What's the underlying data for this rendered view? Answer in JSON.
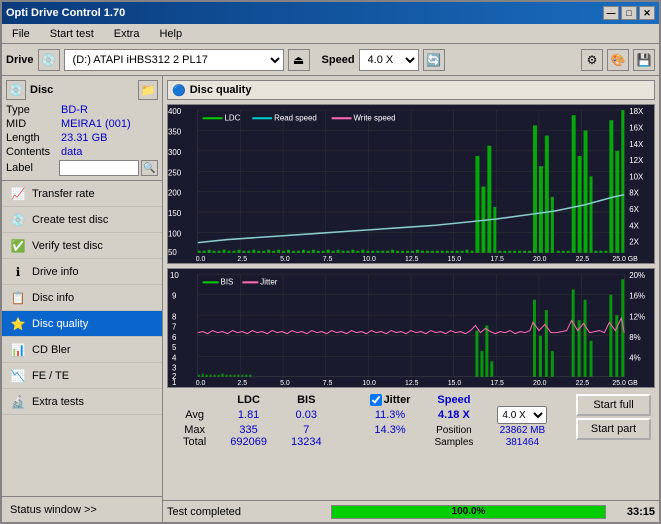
{
  "window": {
    "title": "Opti Drive Control 1.70",
    "controls": [
      "—",
      "□",
      "✕"
    ]
  },
  "menu": {
    "items": [
      "File",
      "Start test",
      "Extra",
      "Help"
    ]
  },
  "toolbar": {
    "drive_label": "Drive",
    "drive_value": "(D:) ATAPI iHBS312  2 PL17",
    "speed_label": "Speed",
    "speed_value": "4.0 X"
  },
  "disc": {
    "title": "Disc",
    "type_label": "Type",
    "type_value": "BD-R",
    "mid_label": "MID",
    "mid_value": "MEIRA1 (001)",
    "length_label": "Length",
    "length_value": "23.31 GB",
    "contents_label": "Contents",
    "contents_value": "data",
    "label_label": "Label"
  },
  "nav": {
    "items": [
      {
        "id": "transfer-rate",
        "label": "Transfer rate",
        "icon": "📈"
      },
      {
        "id": "create-test-disc",
        "label": "Create test disc",
        "icon": "💿"
      },
      {
        "id": "verify-test-disc",
        "label": "Verify test disc",
        "icon": "✅"
      },
      {
        "id": "drive-info",
        "label": "Drive info",
        "icon": "ℹ"
      },
      {
        "id": "disc-info",
        "label": "Disc info",
        "icon": "📋"
      },
      {
        "id": "disc-quality",
        "label": "Disc quality",
        "icon": "⭐",
        "active": true
      },
      {
        "id": "cd-bler",
        "label": "CD Bler",
        "icon": "📊"
      },
      {
        "id": "fe-te",
        "label": "FE / TE",
        "icon": "📉"
      },
      {
        "id": "extra-tests",
        "label": "Extra tests",
        "icon": "🔬"
      }
    ],
    "status_window": "Status window >>"
  },
  "panel": {
    "title": "Disc quality",
    "icon": "🔵"
  },
  "charts": {
    "top": {
      "legend": [
        {
          "label": "LDC",
          "color": "#00cc00"
        },
        {
          "label": "Read speed",
          "color": "#00cccc"
        },
        {
          "label": "Write speed",
          "color": "#ff69b4"
        }
      ],
      "y_left_max": 400,
      "y_right_max": 18,
      "y_right_labels": [
        "18X",
        "16X",
        "14X",
        "12X",
        "10X",
        "8X",
        "6X",
        "4X",
        "2X"
      ],
      "x_labels": [
        "0.0",
        "2.5",
        "5.0",
        "7.5",
        "10.0",
        "12.5",
        "15.0",
        "17.5",
        "20.0",
        "22.5",
        "25.0 GB"
      ]
    },
    "bottom": {
      "legend": [
        {
          "label": "BIS",
          "color": "#00cc00"
        },
        {
          "label": "Jitter",
          "color": "#ff69b4"
        }
      ],
      "y_left_max": 10,
      "y_right_max": 20,
      "y_right_labels": [
        "20%",
        "16%",
        "12%",
        "8%",
        "4%"
      ],
      "x_labels": [
        "0.0",
        "2.5",
        "5.0",
        "7.5",
        "10.0",
        "12.5",
        "15.0",
        "17.5",
        "20.0",
        "22.5",
        "25.0 GB"
      ]
    }
  },
  "stats": {
    "headers": [
      "LDC",
      "BIS",
      "",
      "Jitter",
      "Speed",
      "",
      ""
    ],
    "avg_label": "Avg",
    "avg_ldc": "1.81",
    "avg_bis": "0.03",
    "avg_jitter": "11.3%",
    "avg_speed": "4.18 X",
    "avg_speed_setting": "4.0 X",
    "max_label": "Max",
    "max_ldc": "335",
    "max_bis": "7",
    "max_jitter": "14.3%",
    "max_position": "23862 MB",
    "total_label": "Total",
    "total_ldc": "692069",
    "total_bis": "13234",
    "total_samples": "381464",
    "position_label": "Position",
    "samples_label": "Samples",
    "jitter_checked": true,
    "jitter_label": "Jitter",
    "buttons": {
      "start_full": "Start full",
      "start_part": "Start part"
    }
  },
  "status": {
    "text": "Test completed",
    "progress": 100,
    "progress_text": "100.0%",
    "time": "33:15"
  }
}
